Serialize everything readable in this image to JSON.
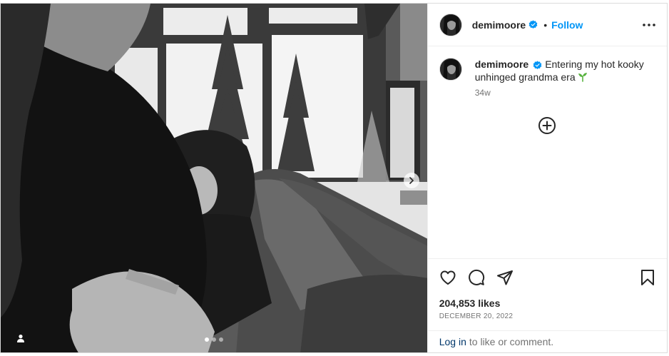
{
  "post": {
    "username": "demimoore",
    "follow_label": "Follow",
    "separator": "•",
    "caption": "Entering my hot kooky unhinged grandma era",
    "caption_emoji": "seedling",
    "timestamp": "34w",
    "likes": "204,853 likes",
    "date": "DECEMBER 20, 2022",
    "login_link": "Log in",
    "login_suffix": "to like or comment."
  },
  "media": {
    "carousel_count": 3,
    "carousel_active_index": 0,
    "description_icons": [
      "chevron-right-icon",
      "user-tag-icon"
    ]
  },
  "icons": {
    "verified": "verified-badge-icon",
    "more": "more-options-icon",
    "add": "plus-circle-icon",
    "like": "heart-icon",
    "comment": "comment-icon",
    "share": "share-icon",
    "save": "bookmark-icon"
  },
  "colors": {
    "accent": "#0095f6",
    "verified": "#0095f6",
    "link_dark": "#00376b",
    "muted": "#737373",
    "sprout": "#58b33f"
  }
}
